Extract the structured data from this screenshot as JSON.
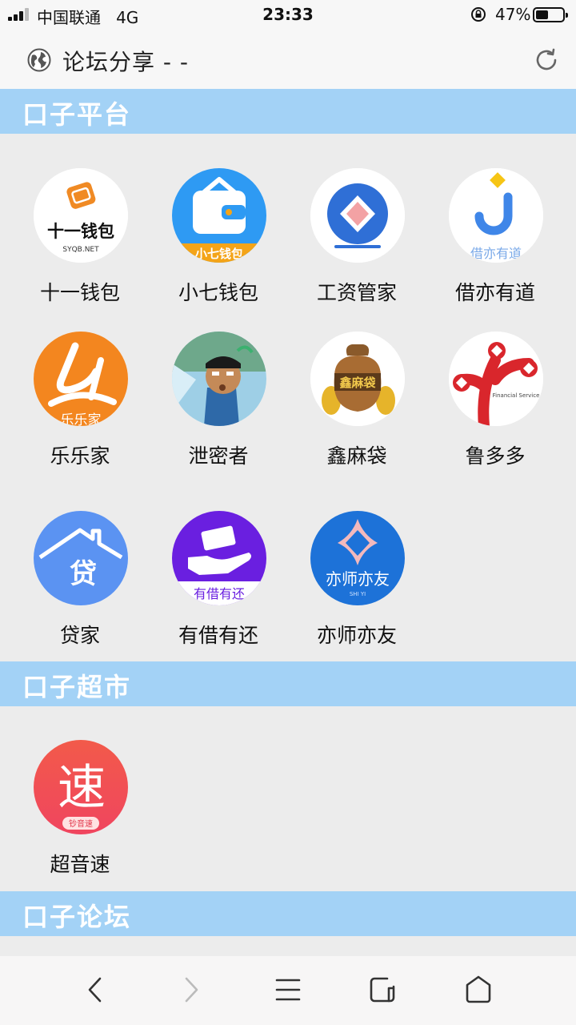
{
  "status": {
    "carrier": "中国联通",
    "network": "4G",
    "time": "23:33",
    "battery_pct": "47%",
    "battery_level": 0.47
  },
  "header": {
    "title": "论坛分享 - -",
    "globe_icon": "globe-icon",
    "reload_icon": "reload-icon"
  },
  "sections": [
    {
      "title": "口子平台",
      "apps": [
        {
          "name": "十一钱包",
          "icon_text": "十一钱包",
          "icon_sub": "SYQB.NET"
        },
        {
          "name": "小七钱包",
          "icon_text": "小七钱包"
        },
        {
          "name": "工资管家"
        },
        {
          "name": "借亦有道",
          "icon_text": "借亦有道"
        },
        {
          "name": "乐乐家",
          "icon_text": "乐乐家"
        },
        {
          "name": "泄密者"
        },
        {
          "name": "鑫麻袋",
          "icon_text": "鑫麻袋"
        },
        {
          "name": "鲁多多",
          "icon_text": "Financial Service"
        },
        {
          "name": "贷家",
          "icon_text": "贷"
        },
        {
          "name": "有借有还",
          "icon_text": "有借有还"
        },
        {
          "name": "亦师亦友",
          "icon_text": "亦师亦友",
          "icon_sub": "SHI YI"
        }
      ]
    },
    {
      "title": "口子超市",
      "apps": [
        {
          "name": "超音速",
          "icon_text": "速",
          "icon_sub": "钞音速"
        }
      ]
    },
    {
      "title": "口子论坛",
      "apps": []
    }
  ],
  "bottom_nav": {
    "back": "back-icon",
    "forward": "forward-icon",
    "menu": "menu-icon",
    "tabs": "tabs-icon",
    "home": "home-icon"
  }
}
